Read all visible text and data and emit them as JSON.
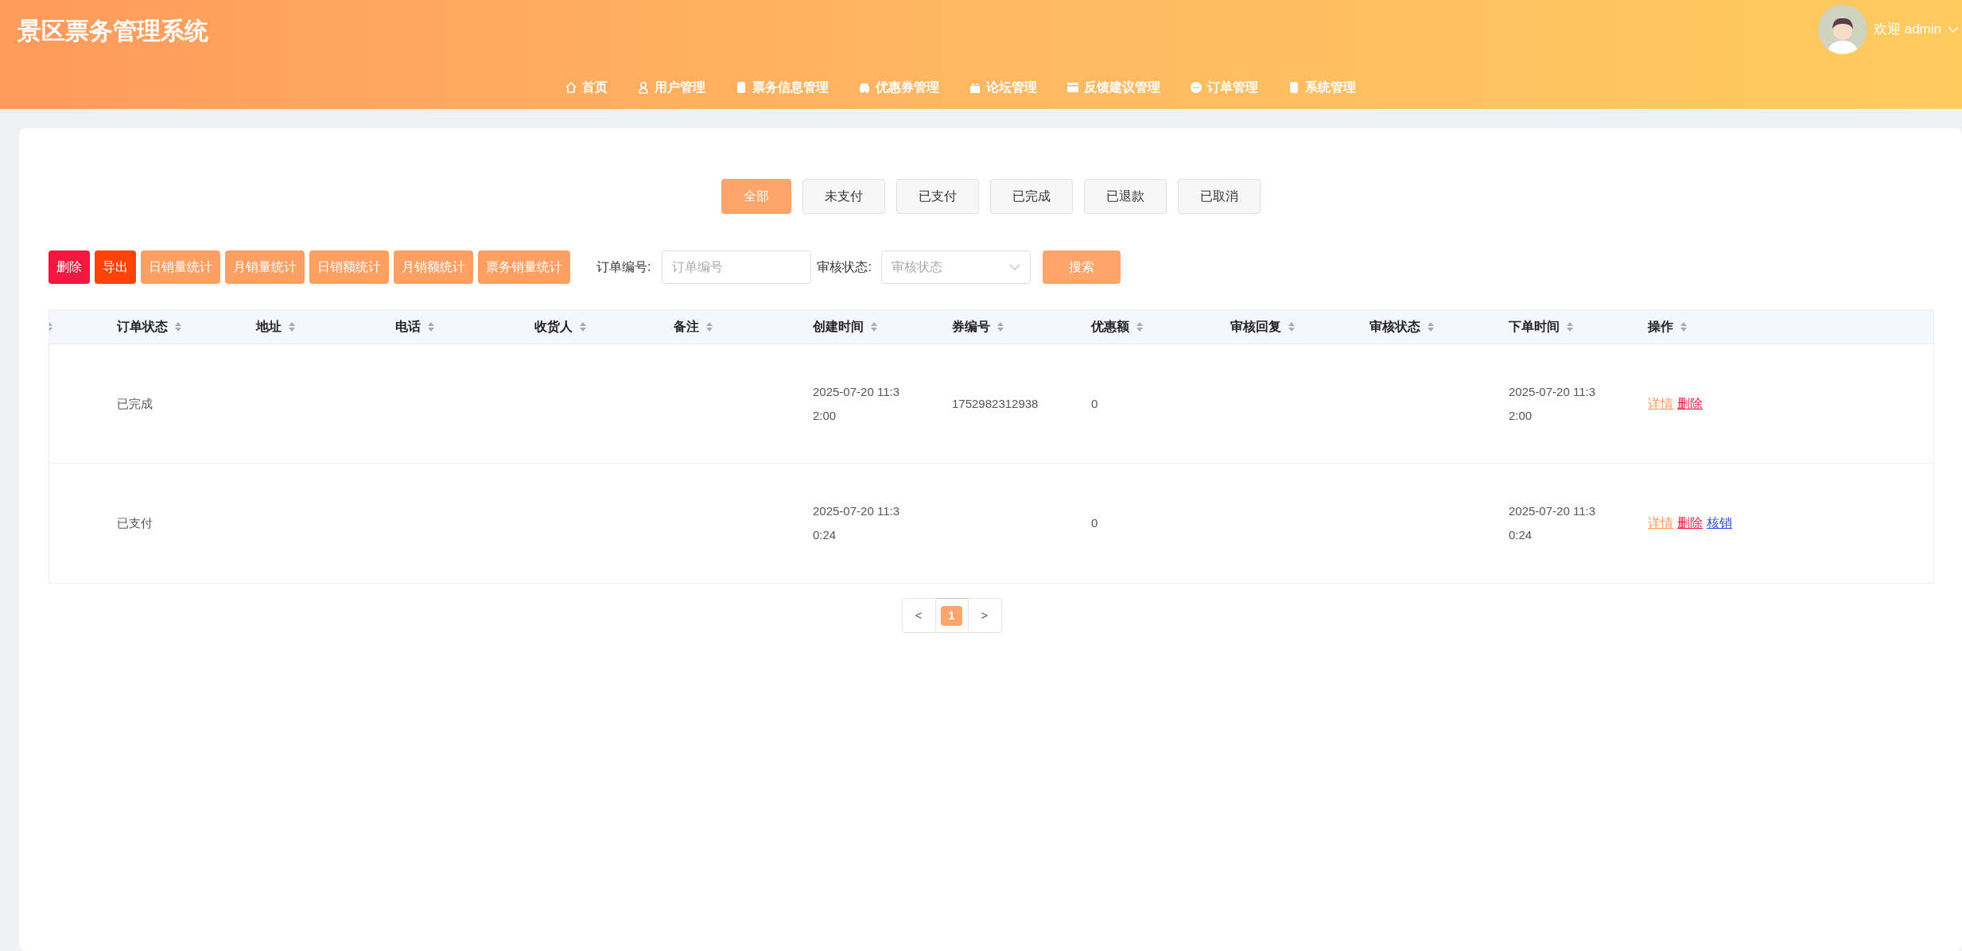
{
  "header": {
    "title": "景区票务管理系统",
    "user": {
      "greeting": "欢迎 admin"
    },
    "nav": [
      {
        "label": "首页"
      },
      {
        "label": "用户管理"
      },
      {
        "label": "票务信息管理"
      },
      {
        "label": "优惠券管理"
      },
      {
        "label": "论坛管理"
      },
      {
        "label": "反馈建议管理"
      },
      {
        "label": "订单管理"
      },
      {
        "label": "系统管理"
      }
    ]
  },
  "status_tabs": [
    {
      "label": "全部",
      "selected": true
    },
    {
      "label": "未支付",
      "selected": false
    },
    {
      "label": "已支付",
      "selected": false
    },
    {
      "label": "已完成",
      "selected": false
    },
    {
      "label": "已退款",
      "selected": false
    },
    {
      "label": "已取消",
      "selected": false
    }
  ],
  "toolbar": {
    "buttons": [
      {
        "label": "删除",
        "kind": "danger"
      },
      {
        "label": "导出",
        "kind": "export"
      },
      {
        "label": "日销量统计",
        "kind": "stat"
      },
      {
        "label": "月销量统计",
        "kind": "stat"
      },
      {
        "label": "日销额统计",
        "kind": "stat"
      },
      {
        "label": "月销额统计",
        "kind": "stat"
      },
      {
        "label": "票务销量统计",
        "kind": "stat"
      }
    ],
    "order_no": {
      "label": "订单编号:",
      "placeholder": "订单编号"
    },
    "review_status": {
      "label": "审核状态:",
      "placeholder": "审核状态"
    },
    "search_button": "搜索"
  },
  "table": {
    "columns": [
      "订单状态",
      "地址",
      "电话",
      "收货人",
      "备注",
      "创建时间",
      "券编号",
      "优惠额",
      "审核回复",
      "审核状态",
      "下单时间",
      "操作"
    ],
    "rows": [
      {
        "cells": [
          "已完成",
          "",
          "",
          "",
          "",
          "2025-07-20 11:32:00",
          "1752982312938",
          "0",
          "",
          "",
          "2025-07-20 11:32:00"
        ],
        "actions": [
          {
            "label": "详情",
            "kind": "detail"
          },
          {
            "label": "删除",
            "kind": "delete"
          }
        ]
      },
      {
        "cells": [
          "已支付",
          "",
          "",
          "",
          "",
          "2025-07-20 11:30:24",
          "",
          "0",
          "",
          "",
          "2025-07-20 11:30:24"
        ],
        "actions": [
          {
            "label": "详情",
            "kind": "detail"
          },
          {
            "label": "删除",
            "kind": "delete"
          },
          {
            "label": "核销",
            "kind": "verify"
          }
        ]
      }
    ]
  },
  "pagination": {
    "prev": "<",
    "pages": [
      {
        "label": "1",
        "selected": true
      }
    ],
    "next": ">"
  }
}
